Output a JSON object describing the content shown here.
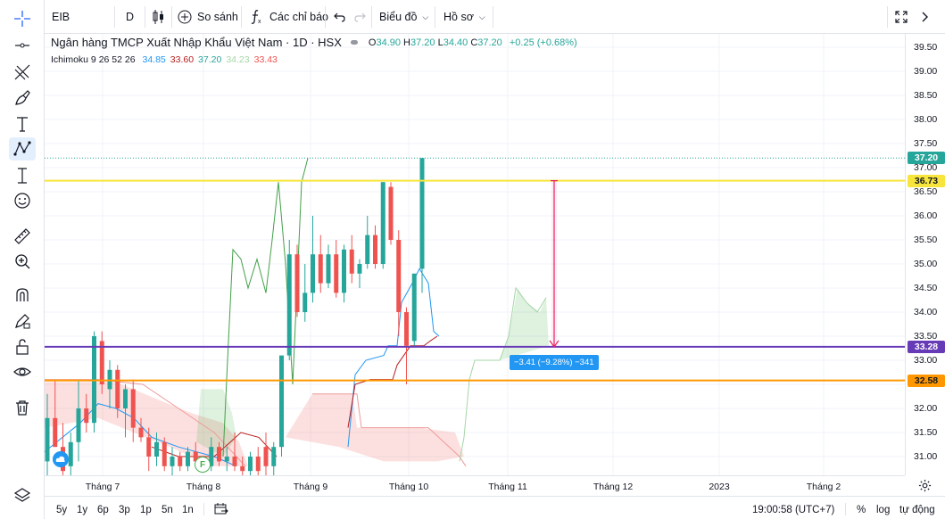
{
  "toolbar": {
    "symbol": "EIB",
    "interval": "D",
    "compare_label": "So sánh",
    "indicators_label": "Các chỉ báo",
    "chart_label": "Biểu đồ",
    "profile_label": "Hồ sơ"
  },
  "legend": {
    "title": "Ngân hàng TMCP Xuất Nhập Khẩu Việt Nam · 1D · HSX",
    "o_label": "O",
    "o": "34.90",
    "h_label": "H",
    "h": "37.20",
    "l_label": "L",
    "l": "34.40",
    "c_label": "C",
    "c": "37.20",
    "change": "+0.25 (+0.68%)"
  },
  "indicator": {
    "name": "Ichimoku 9 26 52 26",
    "values": [
      "34.85",
      "33.60",
      "37.20",
      "34.23",
      "33.43"
    ],
    "colors": [
      "#2196f3",
      "#b71c1c",
      "#26a69a",
      "#a5d6a7",
      "#ef5350"
    ]
  },
  "price_axis": {
    "ticks": [
      "39.50",
      "39.00",
      "38.50",
      "38.00",
      "37.50",
      "37.00",
      "36.50",
      "36.00",
      "35.50",
      "35.00",
      "34.50",
      "34.00",
      "33.50",
      "33.00",
      "32.50",
      "32.00",
      "31.50",
      "31.00"
    ],
    "badges": [
      {
        "label": "37.20",
        "bg": "#26a69a",
        "fg": "#ffffff"
      },
      {
        "label": "36.73",
        "bg": "#f7e53b",
        "fg": "#131722"
      },
      {
        "label": "33.28",
        "bg": "#673ab7",
        "fg": "#ffffff"
      },
      {
        "label": "32.58",
        "bg": "#ff9800",
        "fg": "#131722"
      }
    ]
  },
  "time_axis": {
    "ticks": [
      "Tháng 7",
      "Tháng 8",
      "Tháng 9",
      "Tháng 10",
      "Tháng 11",
      "Tháng 12",
      "2023",
      "Tháng 2"
    ]
  },
  "measure": {
    "label": "−3.41 (−9.28%) −341"
  },
  "events": {
    "earnings_label": "F"
  },
  "bottom": {
    "ranges": [
      "5y",
      "1y",
      "6p",
      "3p",
      "1p",
      "5n",
      "1n"
    ],
    "clock": "19:00:58 (UTC+7)",
    "percent": "%",
    "log": "log",
    "auto": "tự động"
  },
  "chart_data": {
    "type": "candlestick",
    "symbol": "EIB",
    "interval": "1D",
    "horizontal_levels": [
      36.73,
      33.28,
      32.58
    ],
    "last_price": 37.2,
    "ylim": [
      30.75,
      39.75
    ],
    "candles": [
      {
        "o": 30.9,
        "h": 32.3,
        "l": 30.6,
        "c": 31.8
      },
      {
        "o": 31.8,
        "h": 32.6,
        "l": 31.3,
        "c": 31.2
      },
      {
        "o": 31.2,
        "h": 31.7,
        "l": 30.6,
        "c": 30.7
      },
      {
        "o": 30.8,
        "h": 31.5,
        "l": 30.6,
        "c": 31.3
      },
      {
        "o": 31.3,
        "h": 32.6,
        "l": 30.9,
        "c": 32.0
      },
      {
        "o": 32.0,
        "h": 32.3,
        "l": 31.5,
        "c": 31.7
      },
      {
        "o": 31.7,
        "h": 33.6,
        "l": 31.5,
        "c": 33.5
      },
      {
        "o": 33.4,
        "h": 33.6,
        "l": 32.3,
        "c": 32.5
      },
      {
        "o": 32.4,
        "h": 33.0,
        "l": 32.0,
        "c": 32.8
      },
      {
        "o": 32.8,
        "h": 32.9,
        "l": 31.8,
        "c": 32.0
      },
      {
        "o": 32.0,
        "h": 32.5,
        "l": 31.4,
        "c": 32.4
      },
      {
        "o": 32.4,
        "h": 32.6,
        "l": 31.3,
        "c": 31.6
      },
      {
        "o": 31.6,
        "h": 31.8,
        "l": 31.3,
        "c": 31.4
      },
      {
        "o": 31.4,
        "h": 31.6,
        "l": 30.7,
        "c": 31.0
      },
      {
        "o": 31.0,
        "h": 31.5,
        "l": 30.8,
        "c": 31.3
      },
      {
        "o": 31.3,
        "h": 31.4,
        "l": 30.7,
        "c": 30.8
      },
      {
        "o": 30.8,
        "h": 31.2,
        "l": 30.6,
        "c": 31.0
      },
      {
        "o": 31.0,
        "h": 31.1,
        "l": 30.7,
        "c": 30.8
      },
      {
        "o": 30.8,
        "h": 31.2,
        "l": 30.7,
        "c": 31.1
      },
      {
        "o": 31.1,
        "h": 31.3,
        "l": 30.8,
        "c": 30.9
      },
      {
        "o": 30.9,
        "h": 31.0,
        "l": 30.7,
        "c": 30.8
      },
      {
        "o": 30.8,
        "h": 31.4,
        "l": 30.7,
        "c": 31.2
      },
      {
        "o": 31.2,
        "h": 31.3,
        "l": 30.8,
        "c": 30.9
      },
      {
        "o": 30.9,
        "h": 31.2,
        "l": 30.7,
        "c": 31.0
      },
      {
        "o": 31.0,
        "h": 31.5,
        "l": 30.7,
        "c": 30.8
      },
      {
        "o": 30.8,
        "h": 31.0,
        "l": 30.6,
        "c": 30.7
      },
      {
        "o": 30.7,
        "h": 31.1,
        "l": 30.6,
        "c": 31.0
      },
      {
        "o": 31.0,
        "h": 31.2,
        "l": 30.6,
        "c": 30.7
      },
      {
        "o": 31.2,
        "h": 31.5,
        "l": 30.6,
        "c": 30.8
      },
      {
        "o": 30.8,
        "h": 31.3,
        "l": 30.6,
        "c": 31.2
      },
      {
        "o": 31.2,
        "h": 33.1,
        "l": 31.0,
        "c": 33.1
      },
      {
        "o": 33.1,
        "h": 35.5,
        "l": 33.0,
        "c": 35.2
      },
      {
        "o": 35.2,
        "h": 35.4,
        "l": 33.9,
        "c": 34.0
      },
      {
        "o": 34.0,
        "h": 35.0,
        "l": 33.8,
        "c": 34.4
      },
      {
        "o": 34.4,
        "h": 36.0,
        "l": 34.2,
        "c": 35.2
      },
      {
        "o": 35.2,
        "h": 35.6,
        "l": 34.4,
        "c": 34.6
      },
      {
        "o": 34.6,
        "h": 35.4,
        "l": 34.5,
        "c": 35.2
      },
      {
        "o": 35.2,
        "h": 35.5,
        "l": 34.3,
        "c": 34.4
      },
      {
        "o": 34.4,
        "h": 35.4,
        "l": 34.2,
        "c": 35.3
      },
      {
        "o": 35.3,
        "h": 35.6,
        "l": 34.6,
        "c": 34.8
      },
      {
        "o": 34.8,
        "h": 35.1,
        "l": 34.5,
        "c": 35.0
      },
      {
        "o": 35.0,
        "h": 36.0,
        "l": 34.9,
        "c": 35.6
      },
      {
        "o": 35.6,
        "h": 35.8,
        "l": 34.9,
        "c": 35.0
      },
      {
        "o": 35.0,
        "h": 36.7,
        "l": 34.9,
        "c": 36.7
      },
      {
        "o": 36.6,
        "h": 36.7,
        "l": 35.4,
        "c": 35.5
      },
      {
        "o": 35.5,
        "h": 35.7,
        "l": 33.5,
        "c": 34.0
      },
      {
        "o": 34.0,
        "h": 34.1,
        "l": 32.5,
        "c": 33.3
      },
      {
        "o": 33.4,
        "h": 34.8,
        "l": 33.3,
        "c": 34.8
      },
      {
        "o": 34.9,
        "h": 37.2,
        "l": 34.4,
        "c": 37.2
      }
    ]
  }
}
